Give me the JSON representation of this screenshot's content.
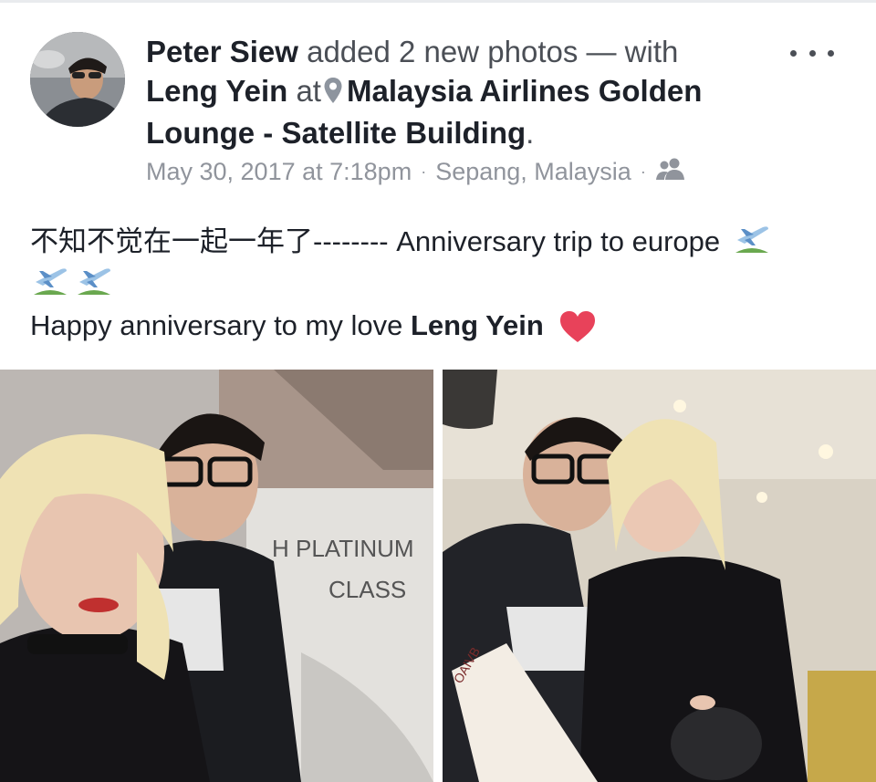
{
  "post": {
    "author": "Peter Siew",
    "action": "added 2 new photos — with",
    "tagged": "Leng Yein",
    "at_word": "at",
    "location": "Malaysia Airlines Golden Lounge - Satellite Building",
    "period": ".",
    "timestamp": "May 30, 2017 at 7:18pm",
    "place": "Sepang, Malaysia",
    "separator": "·",
    "audience_icon": "friends-icon",
    "text_line1": "不知不觉在一起一年了-------- Anniversary trip to europe",
    "text_line3_prefix": "Happy anniversary to my love",
    "text_line3_name": "Leng Yein",
    "emojis": [
      "airplane-departure-emoji",
      "airplane-departure-emoji",
      "airplane-departure-emoji",
      "red-heart-emoji"
    ]
  },
  "photos": {
    "photo1_sign_line1": "H PLATINUM",
    "photo1_sign_line2": "CLASS",
    "photo2_card_text": "OAIVB"
  },
  "icons": {
    "more": "more-options-icon",
    "pin": "location-pin-icon"
  },
  "colors": {
    "text": "#1d2129",
    "muted": "#90949c",
    "heart": "#e8425a"
  }
}
